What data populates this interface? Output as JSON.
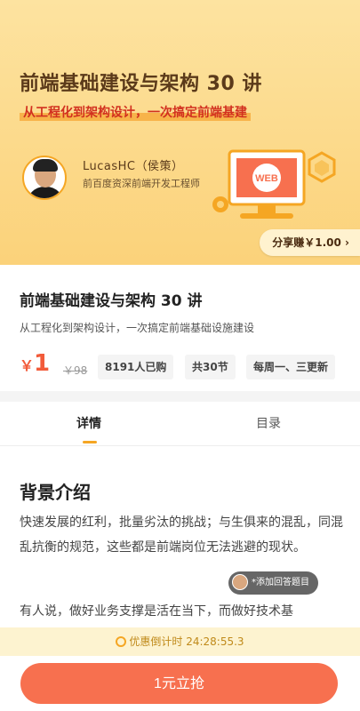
{
  "banner": {
    "title": "前端基础建设与架构 30 讲",
    "subtitle": "从工程化到架构设计，一次搞定前端基建",
    "author_name": "LucasHC（侯策）",
    "author_title": "前百度资深前端开发工程师",
    "web_label": "WEB",
    "share_label": "分享赚￥1.00 ›"
  },
  "course": {
    "title": "前端基础建设与架构 30 讲",
    "description": "从工程化到架构设计，一次搞定前端基础设施建设",
    "price_symbol": "￥",
    "price": "1",
    "original_price": "￥98",
    "tags": [
      "8191人已购",
      "共30节",
      "每周一、三更新"
    ]
  },
  "tabs": [
    {
      "label": "详情",
      "active": true
    },
    {
      "label": "目录",
      "active": false
    }
  ],
  "content": {
    "section_title": "背景介绍",
    "paragraph1": "快速发展的红利，批量劣汰的挑战；与生俱来的混乱，同混乱抗衡的规范，这些都是前端岗位无法逃避的现状。",
    "paragraph2": "有人说，做好业务支撑是活在当下，而做好技术基"
  },
  "toast": {
    "text": "*添加回答题目"
  },
  "countdown": {
    "label": "优惠倒计时 24:28:55.3"
  },
  "buy_button": {
    "label": "1元立抢"
  },
  "colors": {
    "accent": "#f7704f",
    "price": "#f25b3a",
    "banner": "#fbd27a",
    "indicator": "#f5a623"
  }
}
